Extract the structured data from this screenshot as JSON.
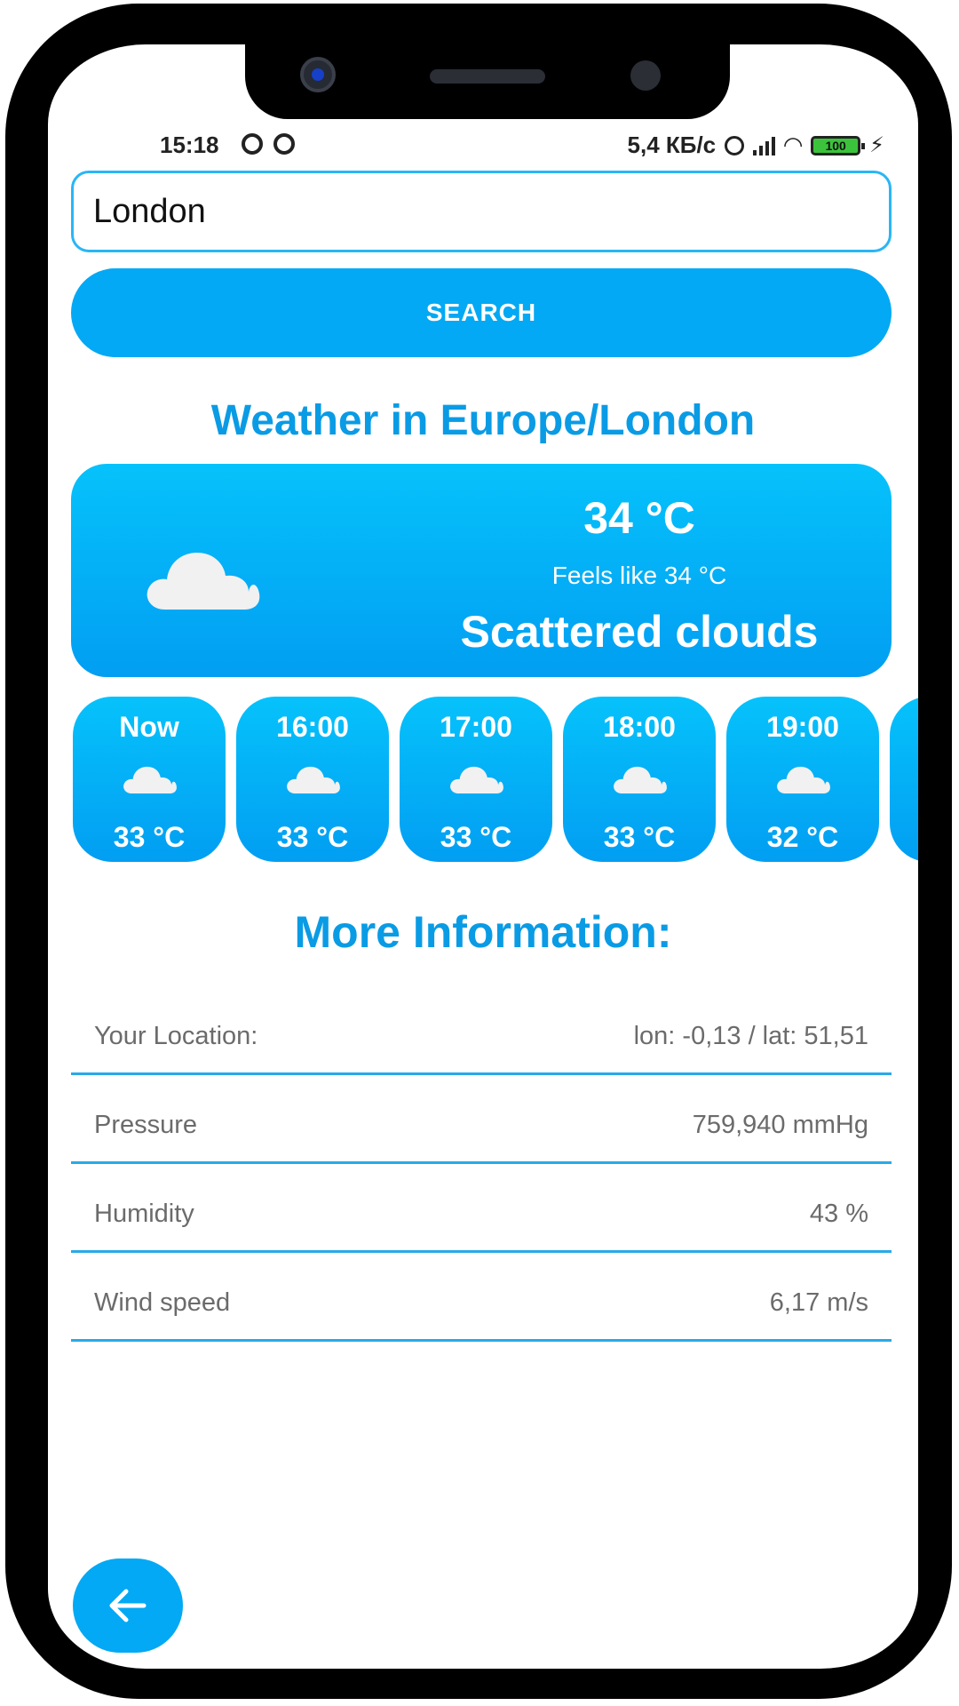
{
  "status_bar": {
    "time": "15:18",
    "net_speed": "5,4 КБ/с",
    "battery": "100"
  },
  "search": {
    "value": "London",
    "button_label": "SEARCH"
  },
  "weather": {
    "heading": "Weather in Europe/London",
    "temperature": "34 °C",
    "feels_like": "Feels like 34 °C",
    "description": "Scattered clouds",
    "icon": "cloud-icon"
  },
  "hourly": [
    {
      "time": "Now",
      "temp": "33 °C"
    },
    {
      "time": "16:00",
      "temp": "33 °C"
    },
    {
      "time": "17:00",
      "temp": "33 °C"
    },
    {
      "time": "18:00",
      "temp": "33 °C"
    },
    {
      "time": "19:00",
      "temp": "32 °C"
    }
  ],
  "more_info": {
    "heading": "More Information:",
    "rows": [
      {
        "label": "Your Location:",
        "value": "lon: -0,13 / lat: 51,51"
      },
      {
        "label": "Pressure",
        "value": "759,940 mmHg"
      },
      {
        "label": "Humidity",
        "value": "43 %"
      },
      {
        "label": "Wind speed",
        "value": "6,17 m/s"
      }
    ]
  },
  "colors": {
    "accent": "#03a9f4",
    "heading": "#0a9be5",
    "frame": "#000000"
  },
  "fab": {
    "icon": "arrow-left-icon"
  }
}
